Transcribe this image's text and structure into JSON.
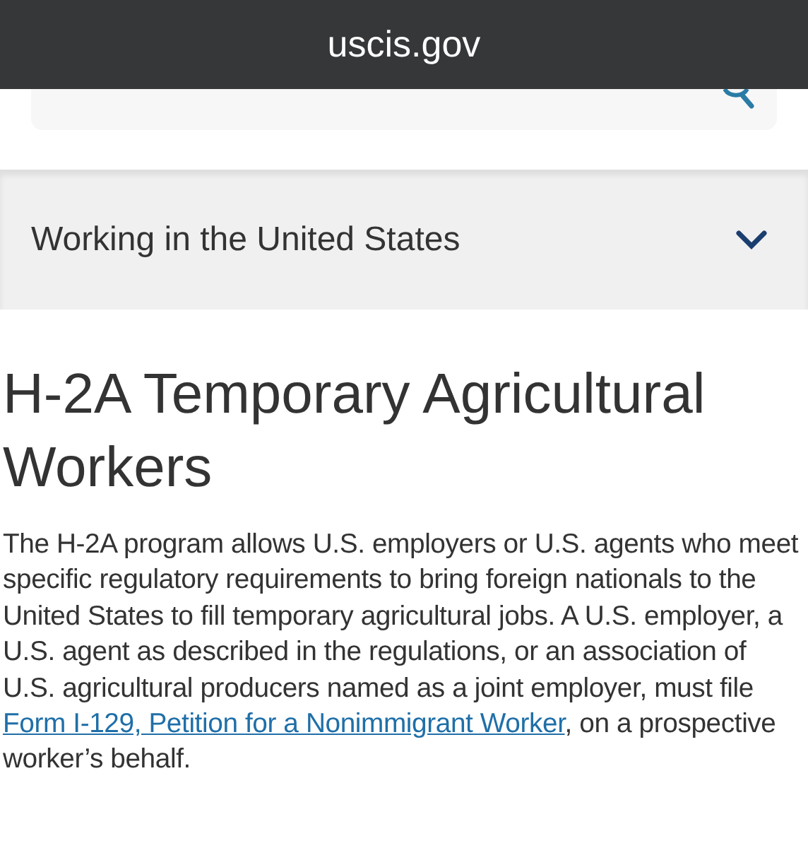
{
  "address_bar": {
    "domain": "uscis.gov"
  },
  "accordion": {
    "label": "Working in the United States",
    "expanded": false
  },
  "heading": "H-2A Temporary Agricultural Workers",
  "intro": {
    "before": "The H-2A program allows U.S. employers or U.S. agents who meet specific regulatory requirements to bring foreign nationals to the United States to fill temporary agricultural jobs. A U.S. employer, a U.S. agent as described in the regulations, or an association of U.S. agricultural producers named as a joint employer, must file ",
    "link": "Form I-129, Petition for a Nonimmigrant Worker",
    "after": ", on a prospective worker’s behalf."
  }
}
